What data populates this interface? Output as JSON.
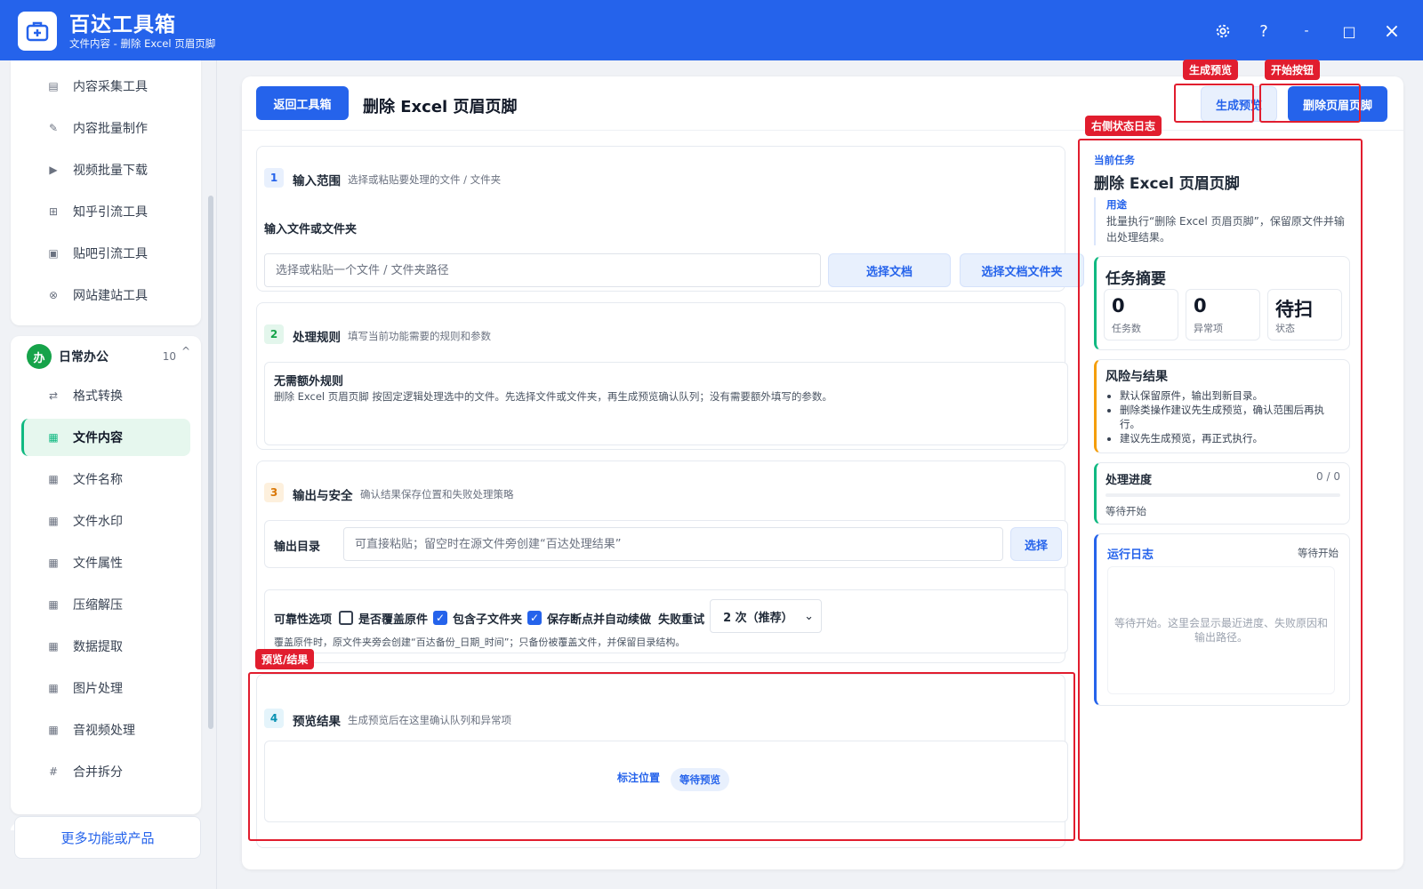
{
  "app": {
    "name": "百达工具箱",
    "subtitle": "文件内容 - 删除 Excel 页眉页脚"
  },
  "window": {
    "settings_icon": "gear-icon",
    "help": "?",
    "minimize": "-",
    "maximize": "□",
    "close": "×"
  },
  "sidebar": {
    "top_items": [
      {
        "icon": "▤",
        "label": "内容采集工具"
      },
      {
        "icon": "✎",
        "label": "内容批量制作"
      },
      {
        "icon": "▶",
        "label": "视频批量下载"
      },
      {
        "icon": "⊞",
        "label": "知乎引流工具"
      },
      {
        "icon": "▣",
        "label": "贴吧引流工具"
      },
      {
        "icon": "⊗",
        "label": "网站建站工具"
      }
    ],
    "group": {
      "badge": "办",
      "title": "日常办公",
      "count": "10",
      "chevron": "^"
    },
    "items": [
      {
        "icon": "⇄",
        "label": "格式转换"
      },
      {
        "icon": "▦",
        "label": "文件内容"
      },
      {
        "icon": "▦",
        "label": "文件名称"
      },
      {
        "icon": "▦",
        "label": "文件水印"
      },
      {
        "icon": "▦",
        "label": "文件属性"
      },
      {
        "icon": "▦",
        "label": "压缩解压"
      },
      {
        "icon": "▦",
        "label": "数据提取"
      },
      {
        "icon": "▦",
        "label": "图片处理"
      },
      {
        "icon": "▦",
        "label": "音视频处理"
      },
      {
        "icon": "#",
        "label": "合并拆分"
      }
    ],
    "active_index": 1,
    "more": "更多功能或产品"
  },
  "header": {
    "back": "返回工具箱",
    "title": "删除 Excel 页眉页脚",
    "preview_btn": "生成预览",
    "start_btn": "删除页眉页脚"
  },
  "annotations": {
    "preview": "生成预览",
    "start": "开始按钮",
    "log": "右侧状态日志",
    "result": "预览/结果"
  },
  "section1": {
    "num": "1",
    "title": "输入范围",
    "desc": "选择或粘贴要处理的文件 / 文件夹",
    "field": "输入文件或文件夹",
    "placeholder": "选择或粘贴一个文件 / 文件夹路径",
    "btn_doc": "选择文档",
    "btn_folder": "选择文档文件夹"
  },
  "section2": {
    "num": "2",
    "title": "处理规则",
    "desc": "填写当前功能需要的规则和参数",
    "rule_title": "无需额外规则",
    "rule_desc": "删除 Excel 页眉页脚 按固定逻辑处理选中的文件。先选择文件或文件夹，再生成预览确认队列；没有需要额外填写的参数。"
  },
  "section3": {
    "num": "3",
    "title": "输出与安全",
    "desc": "确认结果保存位置和失败处理策略",
    "out_label": "输出目录",
    "out_placeholder": "可直接粘贴；留空时在源文件旁创建“百达处理结果”",
    "out_btn": "选择",
    "rel_label": "可靠性选项",
    "opt_overwrite": "是否覆盖原件",
    "opt_sub": "包含子文件夹",
    "opt_resume": "保存断点并自动续做",
    "retry_label": "失败重试",
    "retry_value": "2 次（推荐）",
    "overwrite_checked": false,
    "sub_checked": true,
    "resume_checked": true,
    "note": "覆盖原件时，原文件夹旁会创建“百达备份_日期_时间”；只备份被覆盖文件，并保留目录结构。"
  },
  "section4": {
    "num": "4",
    "title": "预览结果",
    "desc": "生成预览后在这里确认队列和异常项",
    "mark": "标注位置",
    "badge": "等待预览"
  },
  "right": {
    "current_label": "当前任务",
    "current_title": "删除 Excel 页眉页脚",
    "usage_label": "用途",
    "usage_text": "批量执行“删除 Excel 页眉页脚”，保留原文件并输出处理结果。",
    "summary_title": "任务摘要",
    "metrics": [
      {
        "value": "0",
        "label": "任务数"
      },
      {
        "value": "0",
        "label": "异常项"
      },
      {
        "value": "待扫",
        "label": "状态"
      }
    ],
    "risk_title": "风险与结果",
    "risks": [
      "默认保留原件，输出到新目录。",
      "删除类操作建议先生成预览，确认范围后再执行。",
      "建议先生成预览，再正式执行。"
    ],
    "progress_title": "处理进度",
    "progress_count": "0 / 0",
    "progress_fraction": 0,
    "progress_status": "等待开始",
    "log_title": "运行日志",
    "log_status": "等待开始",
    "log_placeholder": "等待开始。这里会显示最近进度、失败原因和输出路径。"
  },
  "colors": {
    "primary": "#2563eb",
    "annotation": "#e11d2e",
    "active_green": "#10b981"
  }
}
